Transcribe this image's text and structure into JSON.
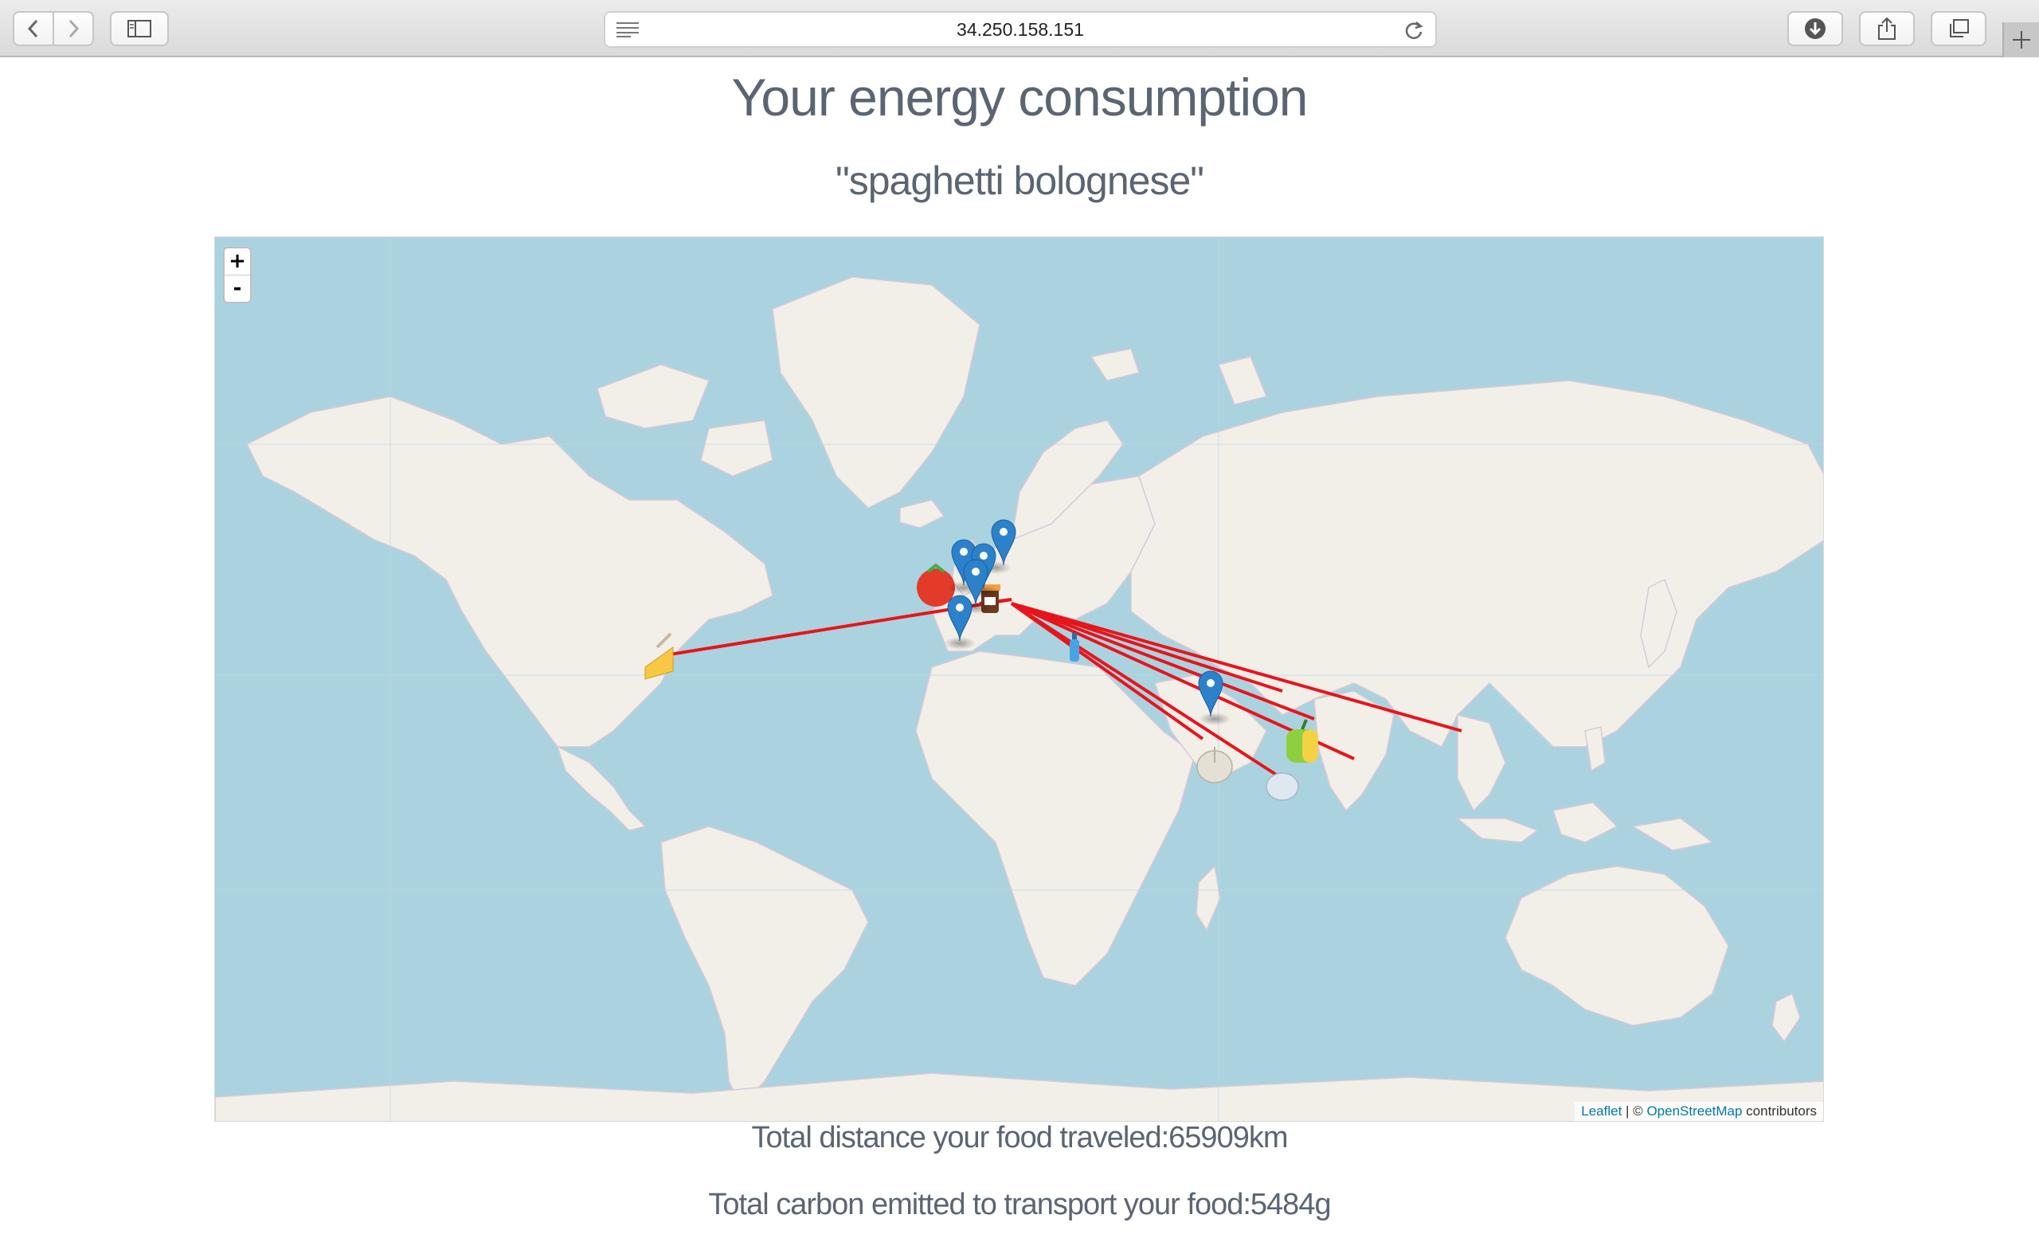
{
  "browser": {
    "address": "34.250.158.151",
    "icons": [
      "back-icon",
      "forward-icon",
      "sidebar-icon",
      "reader-icon",
      "reload-icon",
      "download-icon",
      "share-icon",
      "tabs-icon",
      "new-tab-icon"
    ]
  },
  "page": {
    "title": "Your energy consumption",
    "dish": "\"spaghetti bolognese\""
  },
  "map": {
    "zoom_in": "+",
    "zoom_out": "-",
    "attribution": {
      "leaflet": "Leaflet",
      "separator": " | © ",
      "osm": "OpenStreetMap",
      "suffix": " contributors"
    },
    "route_color": "#e8141b",
    "marker_color": "#2b82cb",
    "water_color": "#aad3df",
    "land_color": "#f2efe9"
  },
  "stats": {
    "distance": "Total distance your food traveled:65909km",
    "carbon": "Total carbon emitted to transport your food:5484g"
  }
}
